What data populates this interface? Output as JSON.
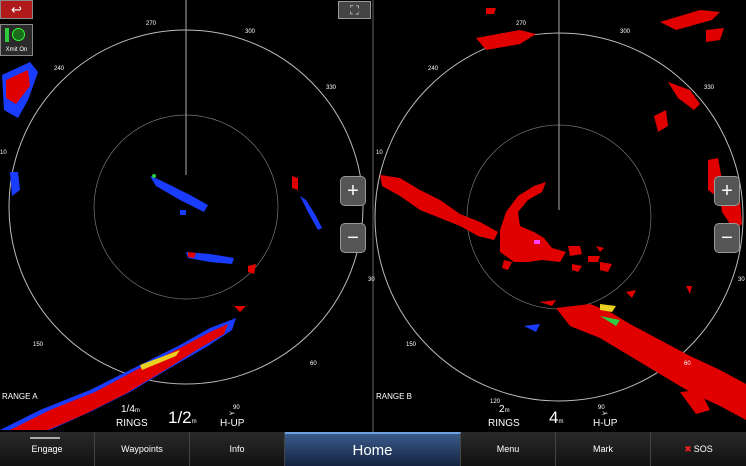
{
  "controls": {
    "back_glyph": "↩",
    "xmit_label": "Xmit On",
    "fullscreen_glyph": "⛶",
    "zoom_in": "+",
    "zoom_out": "−"
  },
  "left_radar": {
    "bearings": [
      "270",
      "300",
      "330",
      "240",
      "10",
      "30",
      "150",
      "60",
      "90"
    ],
    "range_label": "RANGE A",
    "rings_value": "1/4",
    "rings_unit": "m",
    "rings_label": "RINGS",
    "range_value": "1/2",
    "range_unit": "m",
    "heading_mode": "H-UP"
  },
  "right_radar": {
    "bearings": [
      "270",
      "300",
      "330",
      "240",
      "10",
      "30",
      "150",
      "120",
      "60",
      "90"
    ],
    "range_label": "RANGE B",
    "rings_value": "2",
    "rings_unit": "m",
    "rings_label": "RINGS",
    "range_value": "4",
    "range_unit": "m",
    "heading_mode": "H-UP"
  },
  "navbar": {
    "engage": "Engage",
    "waypoints": "Waypoints",
    "info": "Info",
    "home": "Home",
    "menu": "Menu",
    "mark": "Mark",
    "sos": "SOS"
  },
  "colors": {
    "return_strong": "#e00000",
    "return_medium": "#e8d020",
    "return_weak": "#1a3cff",
    "home_active": "#3a5a8a"
  }
}
